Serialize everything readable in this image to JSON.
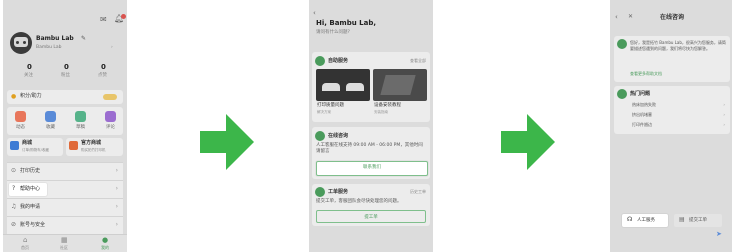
{
  "arrow_color": "#3cb64a",
  "screen1": {
    "user_name": "Bambu Lab",
    "user_sub": "Bambu Lab",
    "stats": [
      {
        "value": "0",
        "label": "关注"
      },
      {
        "value": "0",
        "label": "粉丝"
      },
      {
        "value": "0",
        "label": "点赞"
      }
    ],
    "points_label": "积分/助力",
    "grid_items": [
      "动态",
      "收藏",
      "草稿",
      "评论"
    ],
    "mall_left_title": "商城",
    "mall_left_sub": "订单/购物车/收藏",
    "mall_right_title": "官方商城",
    "mall_right_sub": "购买拓竹打印机",
    "menu": [
      {
        "label": "打印历史"
      },
      {
        "label": "帮助中心"
      },
      {
        "label": "我的申请"
      },
      {
        "label": "账号与安全"
      }
    ],
    "tabs": [
      "首页",
      "社区",
      "我的"
    ]
  },
  "screen2": {
    "title": "Hi, Bambu Lab,",
    "subtitle": "请问有什么问题?",
    "self_service": "自助服务",
    "view_all": "查看全部",
    "article1": "打印质量问题",
    "article1_sub": "解决方案",
    "article2": "设备安装教程",
    "article2_sub": "安装指南",
    "online_title": "在线咨询",
    "online_desc": "人工客服在线支持 09:00 AM - 06:00 PM，其他时间请留言",
    "online_button": "联系我们",
    "ticket_title": "工单服务",
    "ticket_link": "历史工单",
    "ticket_desc": "提交工单，客服团队会尽快处理您的问题。",
    "ticket_button": "提工单"
  },
  "screen3": {
    "title": "在线咨询",
    "bot_message": "您好，我是拓竹 Bambu Lab，很高兴为您服务，请简要描述您遇到的问题，我们将尽快为您解答。",
    "bot_link": "查看更多帮助文档",
    "faq_title": "热门问题",
    "faq": [
      "热床加热失败",
      "挤出机堵塞",
      "打印件翘边"
    ],
    "human_button": "人工服务",
    "ticket_button": "提交工单"
  }
}
